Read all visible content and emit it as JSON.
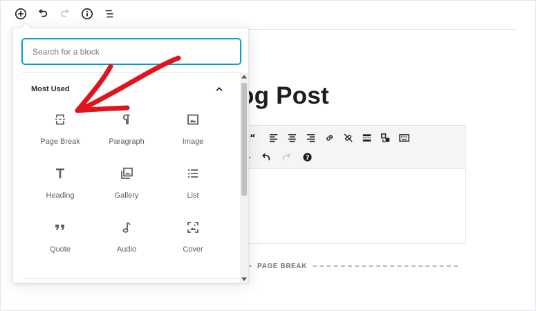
{
  "toolbar": {
    "buttons": [
      {
        "icon": "plus-circle-icon"
      },
      {
        "icon": "undo-icon"
      },
      {
        "icon": "redo-icon"
      },
      {
        "icon": "info-icon"
      },
      {
        "icon": "outline-icon"
      }
    ]
  },
  "post": {
    "title_visible": "og Post",
    "page_break_label": "PAGE BREAK"
  },
  "inserter": {
    "search_placeholder": "Search for a block",
    "search_value": "",
    "panel_title": "Most Used",
    "blocks": [
      {
        "label": "Page Break",
        "icon": "page-break-icon"
      },
      {
        "label": "Paragraph",
        "icon": "paragraph-icon"
      },
      {
        "label": "Image",
        "icon": "image-icon"
      },
      {
        "label": "Heading",
        "icon": "heading-icon"
      },
      {
        "label": "Gallery",
        "icon": "gallery-icon"
      },
      {
        "label": "List",
        "icon": "list-icon"
      },
      {
        "label": "Quote",
        "icon": "quote-icon"
      },
      {
        "label": "Audio",
        "icon": "audio-icon"
      },
      {
        "label": "Cover",
        "icon": "cover-icon"
      }
    ]
  },
  "colors": {
    "focus_border": "#00a0d2",
    "annotation_arrow": "#e0141c",
    "text": "#1e1e1e",
    "label": "#555d66"
  }
}
